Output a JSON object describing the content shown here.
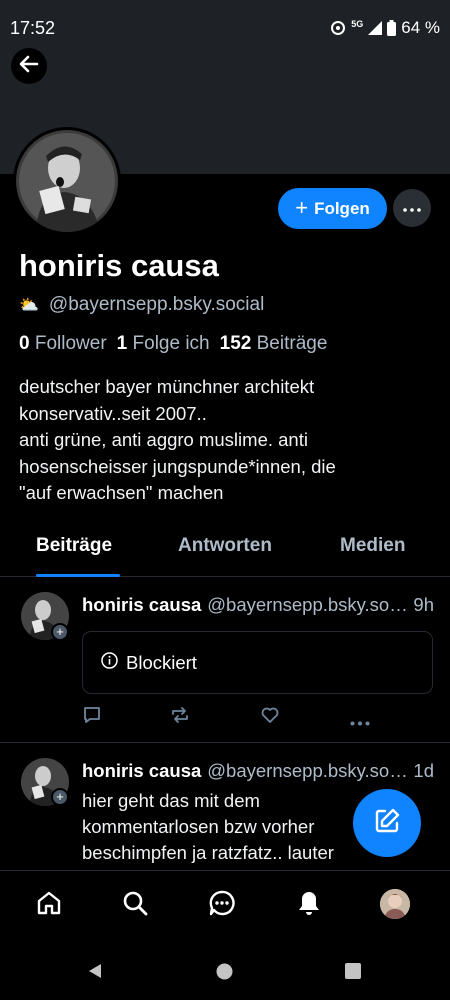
{
  "status_bar": {
    "time": "17:52",
    "network": "5G",
    "battery": "64 %",
    "icons": [
      "data-saver-icon",
      "signal-icon",
      "battery-icon"
    ]
  },
  "header": {
    "back_icon": "arrow-left-icon"
  },
  "profile": {
    "display_name": "honiris causa",
    "handle_emoji": "⛅",
    "handle": "@bayernsepp.bsky.social",
    "follow_label": "Folgen",
    "stats": {
      "followers_count": "0",
      "followers_label": "Follower",
      "following_count": "1",
      "following_label": "Folge ich",
      "posts_count": "152",
      "posts_label": "Beiträge"
    },
    "bio_lines": [
      "deutscher bayer münchner architekt",
      "konservativ..seit 2007..",
      "anti grüne, anti aggro muslime. anti",
      "hosenscheisser jungspunde*innen, die",
      "\"auf erwachsen\" machen"
    ]
  },
  "tabs": [
    {
      "label": "Beiträge",
      "active": true
    },
    {
      "label": "Antworten",
      "active": false
    },
    {
      "label": "Medien",
      "active": false
    }
  ],
  "posts": [
    {
      "author": "honiris causa",
      "handle": "@bayernsepp.bsky.social",
      "time": "9h",
      "blocked_label": "Blockiert"
    },
    {
      "author": "honiris causa",
      "handle": "@bayernsepp.bsky.social",
      "time": "1d",
      "text_lines": [
        "hier geht das mit dem",
        "kommentarlosen  bzw vorher",
        "beschimpfen ja ratzfatz.. lauter"
      ]
    }
  ],
  "bottom_nav": [
    "home-icon",
    "search-icon",
    "chat-icon",
    "notifications-icon",
    "profile-avatar"
  ],
  "colors": {
    "accent": "#1083fe",
    "background": "#000000",
    "banner": "#1e2227",
    "muted_text": "#aebbc9",
    "border": "#252a30"
  }
}
